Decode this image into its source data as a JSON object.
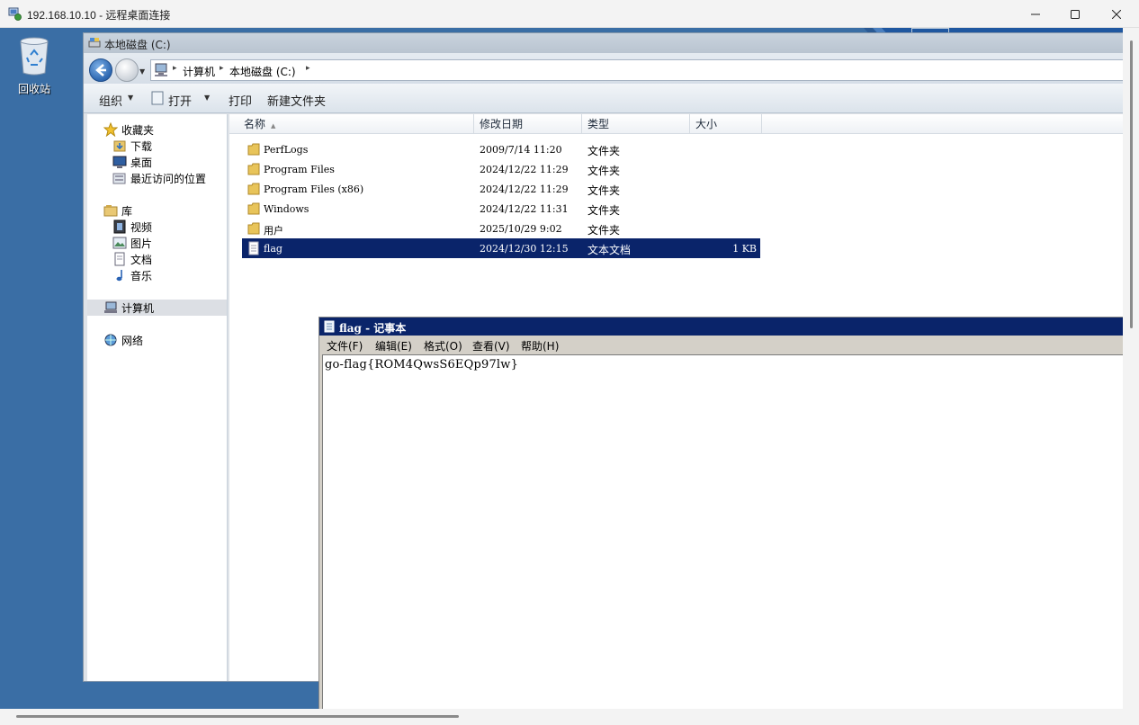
{
  "rdp": {
    "title": "192.168.10.10 - 远程桌面连接"
  },
  "desktop": {
    "recycle_bin_label": "回收站"
  },
  "explorer": {
    "title": "本地磁盘 (C:)",
    "breadcrumb": [
      "计算机",
      "本地磁盘 (C:)"
    ],
    "commands": {
      "organize": "组织",
      "open": "打开",
      "print": "打印",
      "new_folder": "新建文件夹"
    },
    "nav": {
      "favorites": "收藏夹",
      "downloads": "下载",
      "desktop": "桌面",
      "recent": "最近访问的位置",
      "libraries": "库",
      "videos": "视频",
      "pictures": "图片",
      "documents": "文档",
      "music": "音乐",
      "computer": "计算机",
      "network": "网络"
    },
    "columns": {
      "name": "名称",
      "date": "修改日期",
      "type": "类型",
      "size": "大小"
    },
    "files": [
      {
        "name": "PerfLogs",
        "date": "2009/7/14 11:20",
        "type": "文件夹",
        "size": ""
      },
      {
        "name": "Program Files",
        "date": "2024/12/22 11:29",
        "type": "文件夹",
        "size": ""
      },
      {
        "name": "Program Files (x86)",
        "date": "2024/12/22 11:29",
        "type": "文件夹",
        "size": ""
      },
      {
        "name": "Windows",
        "date": "2024/12/22 11:31",
        "type": "文件夹",
        "size": ""
      },
      {
        "name": "用户",
        "date": "2025/10/29 9:02",
        "type": "文件夹",
        "size": ""
      },
      {
        "name": "flag",
        "date": "2024/12/30 12:15",
        "type": "文本文档",
        "size": "1 KB"
      }
    ]
  },
  "notepad": {
    "title": "flag - 记事本",
    "menu": {
      "file": "文件(F)",
      "edit": "编辑(E)",
      "format": "格式(O)",
      "view": "查看(V)",
      "help": "帮助(H)"
    },
    "content": "go-flag{ROM4QwsS6EQp97lw}"
  },
  "colors": {
    "desktop": "#3a6ea5",
    "selection": "#0a246a"
  }
}
